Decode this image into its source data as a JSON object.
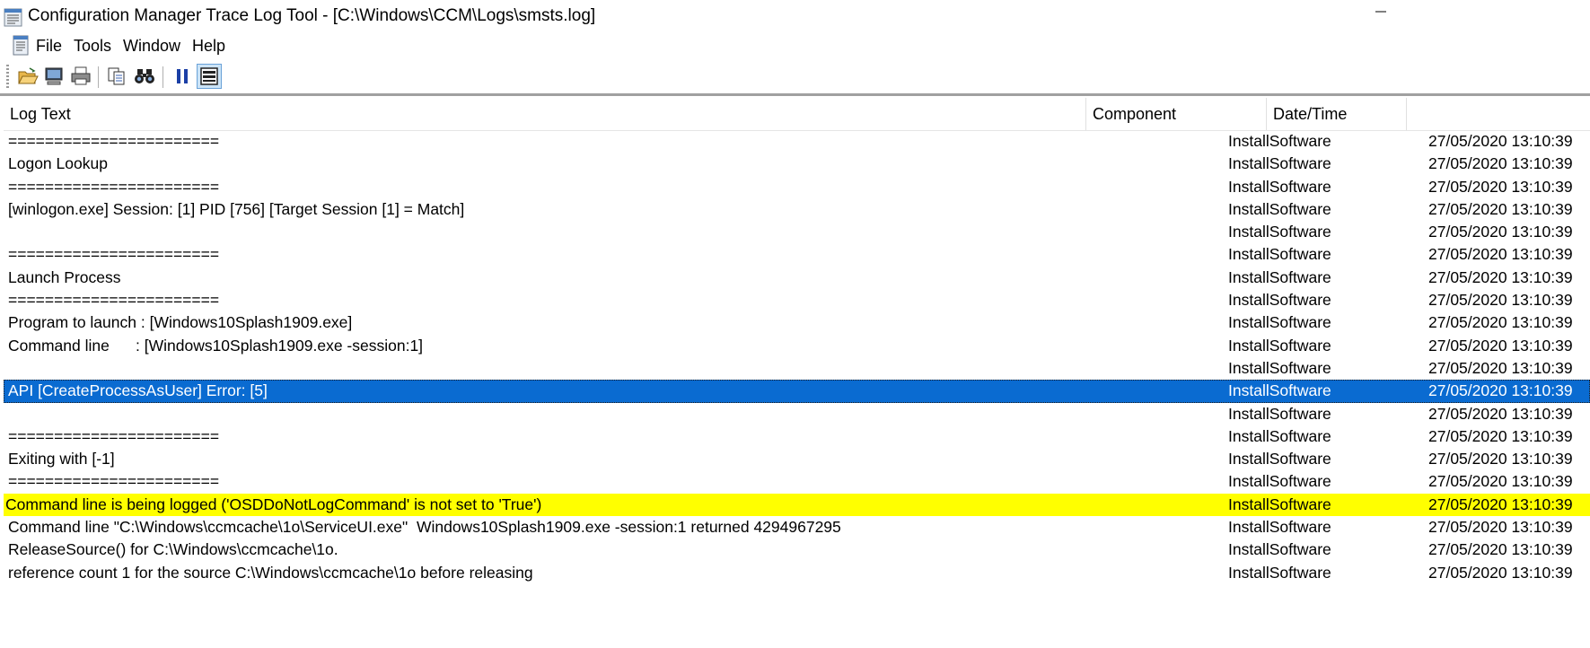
{
  "window": {
    "title": "Configuration Manager Trace Log Tool - [C:\\Windows\\CCM\\Logs\\smsts.log]"
  },
  "menu": {
    "items": [
      "File",
      "Tools",
      "Window",
      "Help"
    ]
  },
  "toolbar": {
    "buttons": [
      "open-folder-icon",
      "computer-icon",
      "print-icon",
      "copy-icon",
      "find-icon",
      "pause-icon",
      "highlight-icon"
    ]
  },
  "grid": {
    "columns": [
      "Log Text",
      "Component",
      "Date/Time"
    ],
    "rows": [
      {
        "text": "=======================",
        "component": "InstallSoftware",
        "date": "27/05/2020 13:10:39"
      },
      {
        "text": "Logon Lookup",
        "component": "InstallSoftware",
        "date": "27/05/2020 13:10:39"
      },
      {
        "text": "=======================",
        "component": "InstallSoftware",
        "date": "27/05/2020 13:10:39"
      },
      {
        "text": "[winlogon.exe] Session: [1] PID [756] [Target Session [1] = Match]",
        "component": "InstallSoftware",
        "date": "27/05/2020 13:10:39"
      },
      {
        "text": "",
        "component": "InstallSoftware",
        "date": "27/05/2020 13:10:39"
      },
      {
        "text": "=======================",
        "component": "InstallSoftware",
        "date": "27/05/2020 13:10:39"
      },
      {
        "text": "Launch Process",
        "component": "InstallSoftware",
        "date": "27/05/2020 13:10:39"
      },
      {
        "text": "=======================",
        "component": "InstallSoftware",
        "date": "27/05/2020 13:10:39"
      },
      {
        "text": "Program to launch : [Windows10Splash1909.exe]",
        "component": "InstallSoftware",
        "date": "27/05/2020 13:10:39"
      },
      {
        "text": "Command line      : [Windows10Splash1909.exe -session:1]",
        "component": "InstallSoftware",
        "date": "27/05/2020 13:10:39"
      },
      {
        "text": "",
        "component": "InstallSoftware",
        "date": "27/05/2020 13:10:39"
      },
      {
        "text": "API [CreateProcessAsUser] Error: [5]",
        "component": "InstallSoftware",
        "date": "27/05/2020 13:10:39",
        "state": "selected"
      },
      {
        "text": "",
        "component": "InstallSoftware",
        "date": "27/05/2020 13:10:39"
      },
      {
        "text": "=======================",
        "component": "InstallSoftware",
        "date": "27/05/2020 13:10:39"
      },
      {
        "text": "Exiting with [-1]",
        "component": "InstallSoftware",
        "date": "27/05/2020 13:10:39"
      },
      {
        "text": "=======================",
        "component": "InstallSoftware",
        "date": "27/05/2020 13:10:39"
      },
      {
        "text": "Command line is being logged ('OSDDoNotLogCommand' is not set to 'True')",
        "component": "InstallSoftware",
        "date": "27/05/2020 13:10:39",
        "state": "highlight",
        "indent": "flush"
      },
      {
        "text": "Command line \"C:\\Windows\\ccmcache\\1o\\ServiceUI.exe\"  Windows10Splash1909.exe -session:1 returned 4294967295",
        "component": "InstallSoftware",
        "date": "27/05/2020 13:10:39",
        "indent": "flush"
      },
      {
        "text": "ReleaseSource() for C:\\Windows\\ccmcache\\1o.",
        "component": "InstallSoftware",
        "date": "27/05/2020 13:10:39",
        "indent": "flush"
      },
      {
        "text": "reference count 1 for the source C:\\Windows\\ccmcache\\1o before releasing",
        "component": "InstallSoftware",
        "date": "27/05/2020 13:10:39",
        "indent": "flush"
      }
    ]
  },
  "colors": {
    "selection": "#0a6bd1",
    "highlight": "#ffff00"
  }
}
